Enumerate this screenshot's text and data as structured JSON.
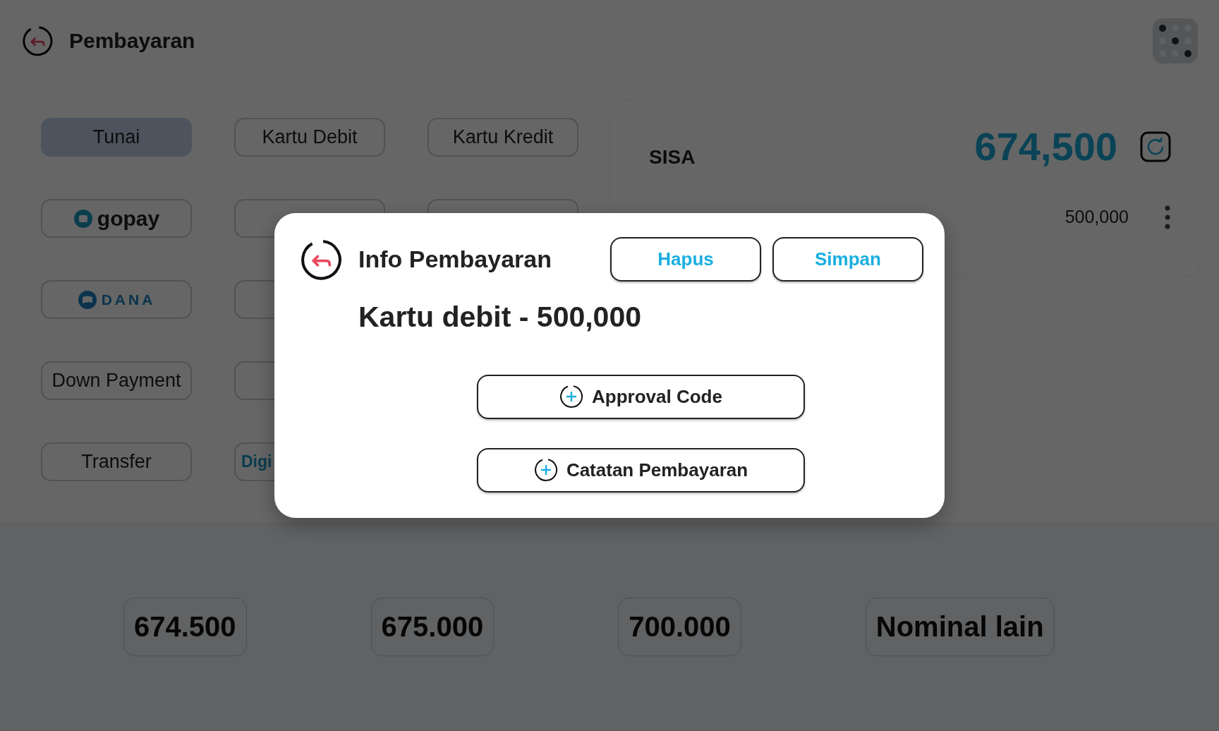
{
  "header": {
    "title": "Pembayaran"
  },
  "method_rows": [
    [
      {
        "kind": "text",
        "label": "Tunai",
        "selected": true
      },
      {
        "kind": "text",
        "label": "Kartu Debit",
        "selected": false
      },
      {
        "kind": "text",
        "label": "Kartu Kredit",
        "selected": false
      }
    ],
    [
      {
        "kind": "gopay",
        "label": "gopay",
        "selected": false
      },
      {
        "kind": "blank",
        "selected": false
      },
      {
        "kind": "blank",
        "selected": false
      }
    ],
    [
      {
        "kind": "dana",
        "label": "DANA",
        "selected": false
      },
      {
        "kind": "blank",
        "selected": false
      }
    ],
    [
      {
        "kind": "text",
        "label": "Down Payment",
        "selected": false
      },
      {
        "kind": "blank",
        "selected": false
      }
    ],
    [
      {
        "kind": "text",
        "label": "Transfer",
        "selected": false
      },
      {
        "kind": "cut",
        "label": "Digi",
        "selected": false
      }
    ]
  ],
  "summary": {
    "label": "SISA",
    "amount": "674,500",
    "payments": [
      {
        "amount": "500,000"
      }
    ]
  },
  "quick_amounts": [
    "674.500",
    "675.000",
    "700.000",
    "Nominal lain"
  ],
  "modal": {
    "title": "Info Pembayaran",
    "buttons": [
      "Hapus",
      "Simpan"
    ],
    "detail": "Kartu debit - 500,000",
    "actions": [
      "Approval Code",
      "Catatan Pembayaran"
    ]
  }
}
